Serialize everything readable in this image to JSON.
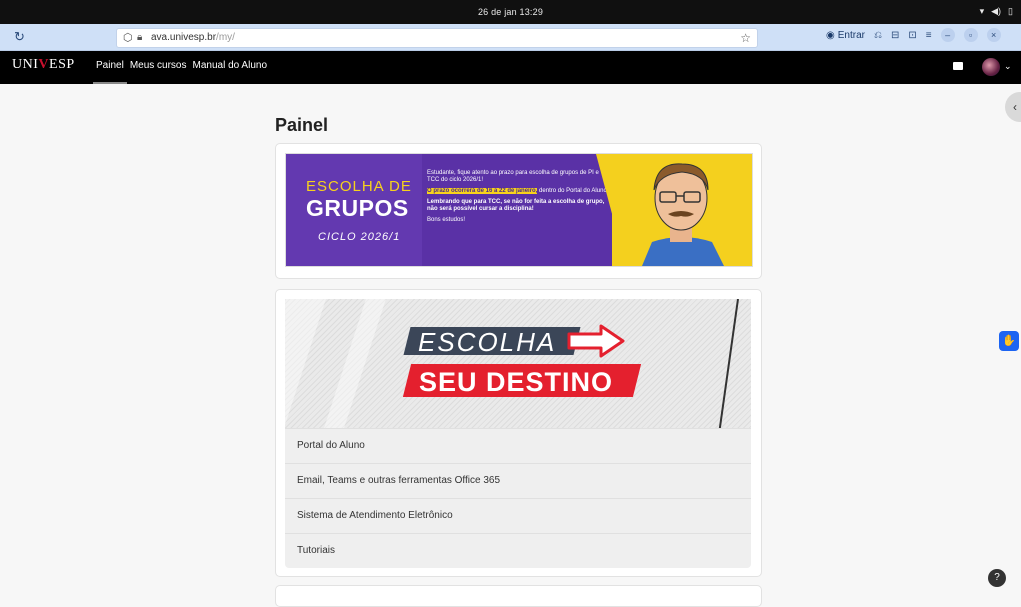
{
  "os": {
    "clock": "26 de jan  13:29",
    "tray_icons": [
      "wifi-icon",
      "volume-icon",
      "battery-icon"
    ]
  },
  "browser": {
    "url_domain": "ava.univesp.br",
    "url_path": "/my/",
    "signin_label": "Entrar"
  },
  "site": {
    "logo_prefix": "UNI",
    "logo_v": "V",
    "logo_suffix": "ESP",
    "nav": [
      {
        "label": "Painel"
      },
      {
        "label": "Meus cursos"
      },
      {
        "label": "Manual do Aluno"
      }
    ]
  },
  "main": {
    "title": "Painel",
    "banner1": {
      "line1": "ESCOLHA DE",
      "line2": "GRUPOS",
      "line3": "CICLO 2026/1",
      "p1": "Estudante, fique atento ao prazo para escolha de grupos de PI e TCC do ciclo 2026/1!",
      "p2_highlight": "O prazo ocorrerá de 16 a 22 de janeiro,",
      "p2_rest": " dentro do Portal do Aluno!",
      "p3": "Lembrando que para TCC, se não for feita a escolha de grupo, não será possível cursar a disciplina!",
      "p4": "Bons estudos!"
    },
    "banner2": {
      "line1": "ESCOLHA",
      "line2": "SEU DESTINO"
    },
    "links": [
      {
        "label": "Portal do Aluno"
      },
      {
        "label": "Email, Teams e outras ferramentas Office 365"
      },
      {
        "label": "Sistema de Atendimento Eletrônico"
      },
      {
        "label": "Tutoriais"
      }
    ]
  },
  "colors": {
    "navbar": "#000000",
    "brand_red": "#c8102e",
    "banner_purple": "#6339b0",
    "banner_yellow": "#f4d01e",
    "accessibility_blue": "#1c64f2"
  }
}
